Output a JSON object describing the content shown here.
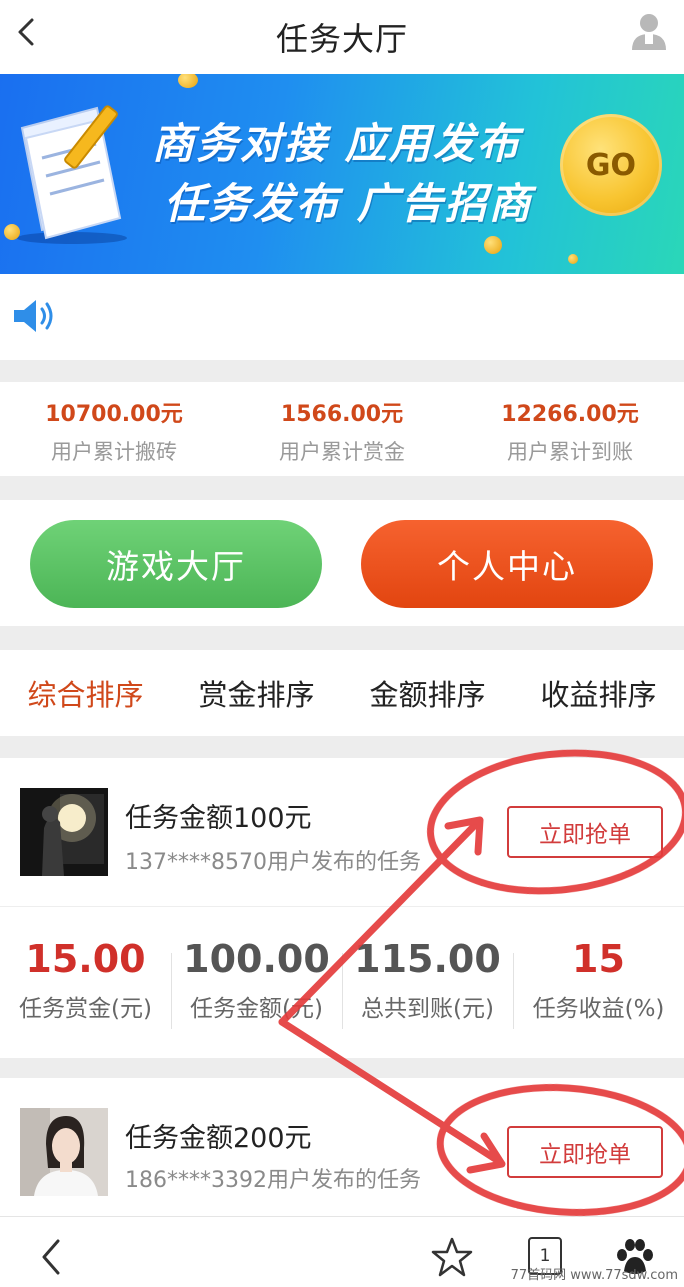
{
  "header": {
    "title": "任务大厅"
  },
  "banner": {
    "line1": "商务对接 应用发布",
    "line2": "任务发布 广告招商",
    "go": "GO"
  },
  "stats": [
    {
      "value": "10700.00元",
      "label": "用户累计搬砖"
    },
    {
      "value": "1566.00元",
      "label": "用户累计赏金"
    },
    {
      "value": "12266.00元",
      "label": "用户累计到账"
    }
  ],
  "buttons": {
    "game_hall": "游戏大厅",
    "personal_center": "个人中心"
  },
  "sort_tabs": [
    "综合排序",
    "赏金排序",
    "金额排序",
    "收益排序"
  ],
  "tasks": [
    {
      "amount": "任务金额100元",
      "publisher": "137****8570用户发布的任务",
      "action": "立即抢单"
    },
    {
      "amount": "任务金额200元",
      "publisher": "186****3392用户发布的任务",
      "action": "立即抢单"
    }
  ],
  "metrics": [
    {
      "value": "15.00",
      "label": "任务赏金(元)",
      "color": "#d0302a"
    },
    {
      "value": "100.00",
      "label": "任务金额(元)",
      "color": "#555555"
    },
    {
      "value": "115.00",
      "label": "总共到账(元)",
      "color": "#555555"
    },
    {
      "value": "15",
      "label": "任务收益(%)",
      "color": "#d0302a"
    }
  ],
  "bottom_nav": {
    "tab_count": "1"
  },
  "watermark": "77首码网 www.77sdw.com"
}
